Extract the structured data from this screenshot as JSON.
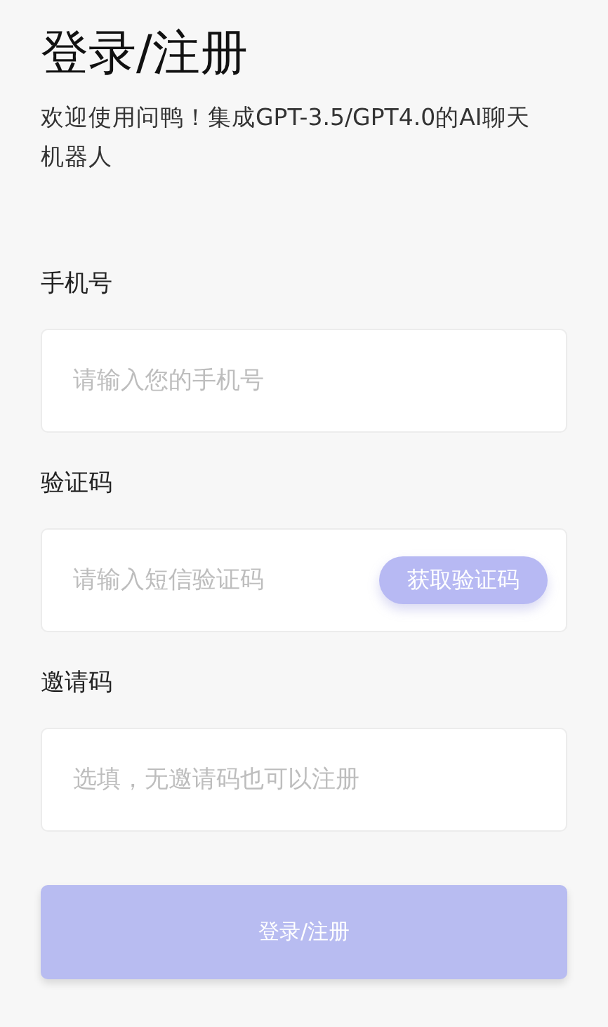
{
  "title": "登录/注册",
  "subtitle": "欢迎使用问鸭！集成GPT-3.5/GPT4.0的AI聊天机器人",
  "fields": [
    {
      "label": "手机号",
      "placeholder": "请输入您的手机号",
      "kind": "plain"
    },
    {
      "label": "验证码",
      "placeholder": "请输入短信验证码",
      "kind": "code",
      "action": "获取验证码"
    },
    {
      "label": "邀请码",
      "placeholder": "选填，无邀请码也可以注册",
      "kind": "plain"
    }
  ],
  "submit": {
    "label": "登录/注册",
    "disabled": true
  }
}
